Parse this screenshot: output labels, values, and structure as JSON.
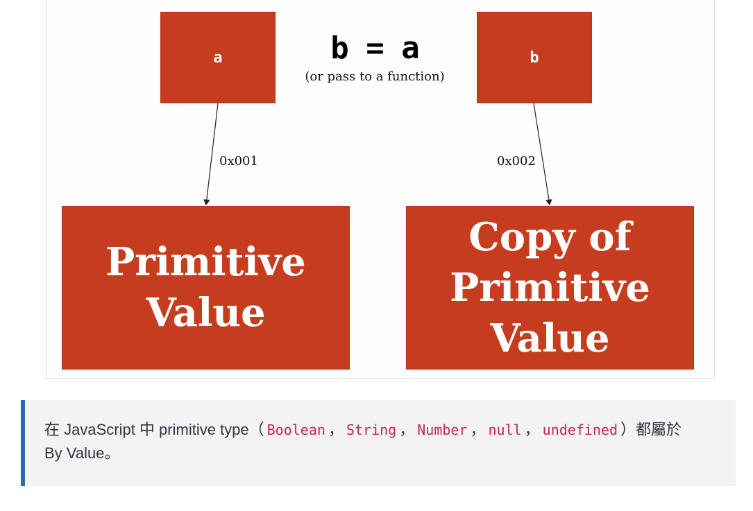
{
  "diagram": {
    "equation": "b = a",
    "equation_note": "(or pass to a function)",
    "var_a": "a",
    "var_b": "b",
    "addr_a": "0x001",
    "addr_b": "0x002",
    "value_a": "Primitive\nValue",
    "value_b": "Copy of\nPrimitive\nValue",
    "box_color": "#c53d1e"
  },
  "note": {
    "prefix": "在 JavaScript 中 primitive type（",
    "types": [
      "Boolean",
      "String",
      "Number",
      "null",
      "undefined"
    ],
    "separator": "，",
    "suffix": "）都屬於",
    "line2": "By Value。",
    "accent_color": "#2e6da4",
    "code_color": "#c7254e"
  }
}
